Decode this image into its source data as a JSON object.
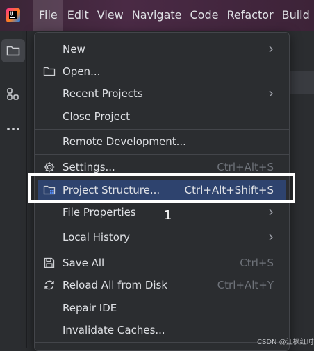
{
  "menubar": {
    "items": [
      {
        "label": "File",
        "active": true
      },
      {
        "label": "Edit"
      },
      {
        "label": "View"
      },
      {
        "label": "Navigate"
      },
      {
        "label": "Code"
      },
      {
        "label": "Refactor"
      },
      {
        "label": "Build"
      }
    ]
  },
  "sidebar": {
    "icons": [
      "folder-icon",
      "structure-icon",
      "more-icon"
    ]
  },
  "file_menu": {
    "new": {
      "label": "New"
    },
    "open": {
      "label": "Open..."
    },
    "recent_projects": {
      "label": "Recent Projects"
    },
    "close_project": {
      "label": "Close Project"
    },
    "remote_development": {
      "label": "Remote Development..."
    },
    "settings": {
      "label": "Settings...",
      "shortcut": "Ctrl+Alt+S"
    },
    "project_structure": {
      "label": "Project Structure...",
      "shortcut": "Ctrl+Alt+Shift+S"
    },
    "file_properties": {
      "label": "File Properties"
    },
    "local_history": {
      "label": "Local History"
    },
    "save_all": {
      "label": "Save All",
      "shortcut": "Ctrl+S"
    },
    "reload_all": {
      "label": "Reload All from Disk",
      "shortcut": "Ctrl+Alt+Y"
    },
    "repair_ide": {
      "label": "Repair IDE"
    },
    "invalidate_caches": {
      "label": "Invalidate Caches..."
    }
  },
  "annotation": {
    "number": "1"
  },
  "watermark": "CSDN @江枫红时",
  "colors": {
    "background": "#2b2d30",
    "selection": "#2e436e",
    "titlebar": "#4a2a45",
    "annotation": "#ffffff"
  }
}
